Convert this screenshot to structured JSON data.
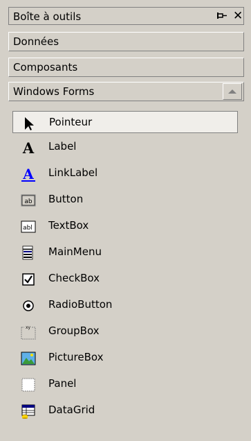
{
  "toolbox": {
    "title": "Boîte à outils",
    "close_glyph": "✕"
  },
  "tabs": [
    {
      "label": "Données"
    },
    {
      "label": "Composants"
    },
    {
      "label": "Windows Forms"
    }
  ],
  "items": [
    {
      "label": "Pointeur",
      "icon": "pointer-icon",
      "selected": true
    },
    {
      "label": "Label",
      "icon": "label-icon"
    },
    {
      "label": "LinkLabel",
      "icon": "linklabel-icon"
    },
    {
      "label": "Button",
      "icon": "button-icon"
    },
    {
      "label": "TextBox",
      "icon": "textbox-icon"
    },
    {
      "label": "MainMenu",
      "icon": "mainmenu-icon"
    },
    {
      "label": "CheckBox",
      "icon": "checkbox-icon"
    },
    {
      "label": "RadioButton",
      "icon": "radiobutton-icon"
    },
    {
      "label": "GroupBox",
      "icon": "groupbox-icon"
    },
    {
      "label": "PictureBox",
      "icon": "picturebox-icon"
    },
    {
      "label": "Panel",
      "icon": "panel-icon"
    },
    {
      "label": "DataGrid",
      "icon": "datagrid-icon"
    }
  ],
  "colors": {
    "background": "#d4d0c8",
    "link_blue": "#0000ff",
    "selected_bg": "#f0eeea"
  }
}
